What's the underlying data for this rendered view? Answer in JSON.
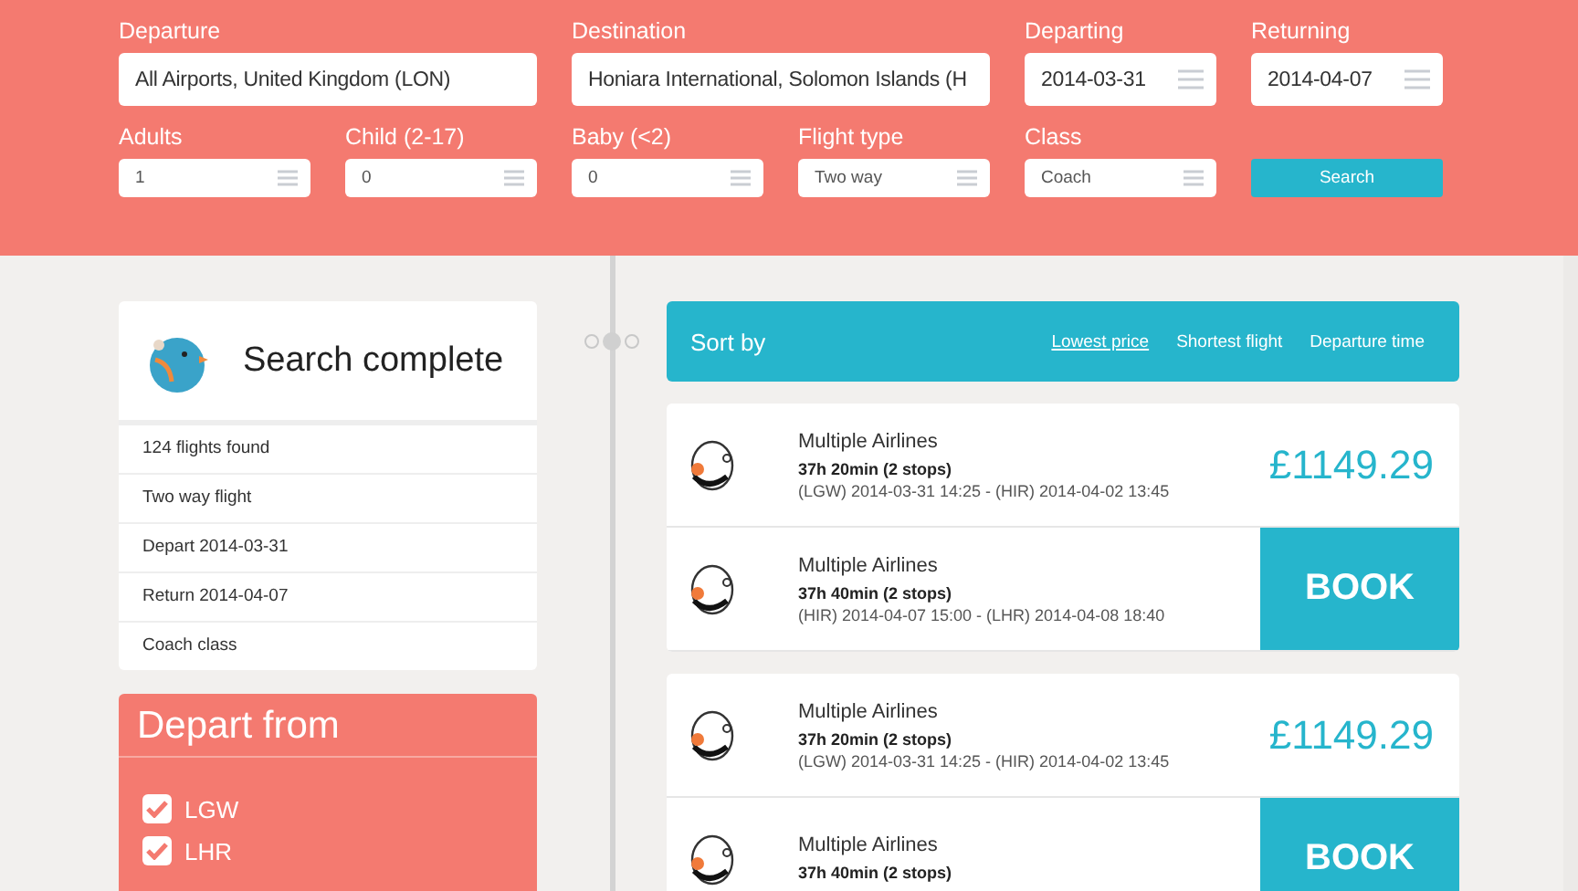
{
  "search_form": {
    "row_1": [
      {
        "label": "Departure",
        "value": "All Airports, United Kingdom (LON)",
        "kind": "text"
      },
      {
        "label": "Destination",
        "value": "Honiara International, Solomon Islands (H",
        "kind": "text"
      },
      {
        "label": "Departing",
        "value": "2014-03-31",
        "kind": "select"
      },
      {
        "label": "Returning",
        "value": "2014-04-07",
        "kind": "select"
      }
    ],
    "row_2": [
      {
        "label": "Adults",
        "value": "1"
      },
      {
        "label": "Child (2-17)",
        "value": "0"
      },
      {
        "label": "Baby (<2)",
        "value": "0"
      },
      {
        "label": "Flight type",
        "value": "Two way"
      },
      {
        "label": "Class",
        "value": "Coach"
      }
    ],
    "search_button": "Search"
  },
  "summary": {
    "title": "Search complete",
    "items": [
      "124 flights found",
      "Two way flight",
      "Depart 2014-03-31",
      "Return 2014-04-07",
      "Coach class"
    ]
  },
  "depart_from": {
    "title": "Depart from",
    "options": [
      {
        "label": "LGW",
        "checked": true
      },
      {
        "label": "LHR",
        "checked": true
      }
    ]
  },
  "sort_bar": {
    "title": "Sort by",
    "options": [
      {
        "label": "Lowest price",
        "selected": true
      },
      {
        "label": "Shortest flight",
        "selected": false
      },
      {
        "label": "Departure time",
        "selected": false
      }
    ]
  },
  "results": [
    {
      "legs": [
        {
          "airline": "Multiple Airlines",
          "duration": "37h 20min (2 stops)",
          "route": "(LGW) 2014-03-31 14:25 - (HIR) 2014-04-02 13:45",
          "kind": "price",
          "action": "£1149.29"
        },
        {
          "airline": "Multiple Airlines",
          "duration": "37h 40min (2 stops)",
          "route": "(HIR) 2014-04-07 15:00 - (LHR) 2014-04-08 18:40",
          "kind": "book",
          "action": "BOOK"
        }
      ]
    },
    {
      "legs": [
        {
          "airline": "Multiple Airlines",
          "duration": "37h 20min (2 stops)",
          "route": "(LGW) 2014-03-31 14:25 - (HIR) 2014-04-02 13:45",
          "kind": "price",
          "action": "£1149.29"
        },
        {
          "airline": "Multiple Airlines",
          "duration": "37h 40min (2 stops)",
          "kind": "book",
          "action": "BOOK"
        }
      ]
    }
  ]
}
